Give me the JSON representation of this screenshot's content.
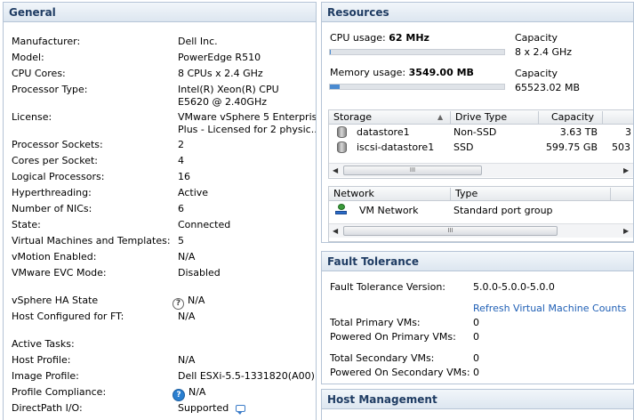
{
  "general": {
    "title": "General",
    "rows": [
      {
        "label": "Manufacturer:",
        "value": "Dell Inc."
      },
      {
        "label": "Model:",
        "value": "PowerEdge R510"
      },
      {
        "label": "CPU Cores:",
        "value": "8 CPUs x 2.4 GHz"
      },
      {
        "label": "Processor Type:",
        "value": "Intel(R) Xeon(R) CPU E5620 @ 2.40GHz"
      },
      {
        "label": "License:",
        "value": "VMware vSphere 5 Enterprise Plus - Licensed for 2 physic..."
      },
      {
        "label": "Processor Sockets:",
        "value": "2"
      },
      {
        "label": "Cores per Socket:",
        "value": "4"
      },
      {
        "label": "Logical Processors:",
        "value": "16"
      },
      {
        "label": "Hyperthreading:",
        "value": "Active"
      },
      {
        "label": "Number of NICs:",
        "value": "6"
      },
      {
        "label": "State:",
        "value": "Connected"
      },
      {
        "label": "Virtual Machines and Templates:",
        "value": "5"
      },
      {
        "label": "vMotion Enabled:",
        "value": "N/A"
      },
      {
        "label": "VMware EVC Mode:",
        "value": "Disabled"
      },
      {
        "label": "vSphere HA State",
        "value": "N/A"
      },
      {
        "label": "Host Configured for FT:",
        "value": "N/A"
      },
      {
        "label": "Active Tasks:",
        "value": ""
      },
      {
        "label": "Host Profile:",
        "value": "N/A"
      },
      {
        "label": "Image Profile:",
        "value": "Dell ESXi-5.5-1331820(A00)"
      },
      {
        "label": "Profile Compliance:",
        "value": "N/A"
      },
      {
        "label": "DirectPath I/O:",
        "value": "Supported"
      }
    ]
  },
  "resources": {
    "title": "Resources",
    "cpu_label": "CPU usage:",
    "cpu_value": "62 MHz",
    "cpu_fraction": 0.003,
    "cpu_capacity_label": "Capacity",
    "cpu_capacity_value": "8 x 2.4 GHz",
    "mem_label": "Memory usage:",
    "mem_value": "3549.00 MB",
    "mem_fraction": 0.054,
    "mem_capacity_label": "Capacity",
    "mem_capacity_value": "65523.02 MB",
    "storage": {
      "columns": [
        "Storage",
        "Drive Type",
        "Capacity"
      ],
      "rows": [
        {
          "name": "datastore1",
          "type": "Non-SSD",
          "capacity": "3.63 TB",
          "extra": "3"
        },
        {
          "name": "iscsi-datastore1",
          "type": "SSD",
          "capacity": "599.75 GB",
          "extra": "503"
        }
      ]
    },
    "network": {
      "columns": [
        "Network",
        "Type"
      ],
      "rows": [
        {
          "name": "VM Network",
          "type": "Standard port group"
        }
      ]
    },
    "scroll_grip": "III"
  },
  "fault_tolerance": {
    "title": "Fault Tolerance",
    "version_label": "Fault Tolerance Version:",
    "version_value": "5.0.0-5.0.0-5.0.0",
    "refresh_link": "Refresh Virtual Machine Counts",
    "total_primary_label": "Total Primary VMs:",
    "total_primary_value": "0",
    "powered_primary_label": "Powered On Primary VMs:",
    "powered_primary_value": "0",
    "total_secondary_label": "Total Secondary VMs:",
    "total_secondary_value": "0",
    "powered_secondary_label": "Powered On Secondary VMs:",
    "powered_secondary_value": "0"
  },
  "host_management": {
    "title": "Host Management"
  }
}
